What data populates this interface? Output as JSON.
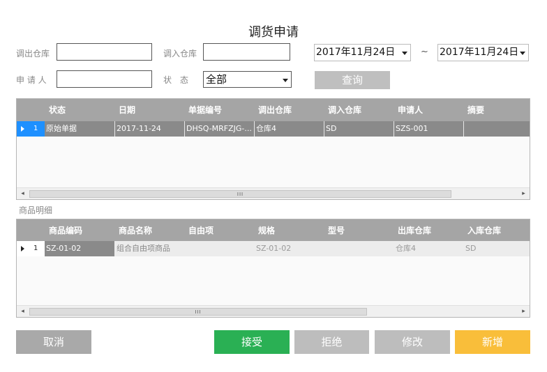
{
  "title": "调货申请",
  "filters": {
    "out_wh_label": "调出仓库",
    "out_wh_value": "",
    "in_wh_label": "调入仓库",
    "in_wh_value": "",
    "applicant_label": "申 请 人",
    "applicant_value": "",
    "status_label": "状　态",
    "status_value": "全部",
    "date_from": "2017年11月24日",
    "date_to": "2017年11月24日",
    "tilde": "~",
    "query_button": "查询"
  },
  "top_grid": {
    "columns": [
      "状态",
      "日期",
      "单据编号",
      "调出仓库",
      "调入仓库",
      "申请人",
      "摘要"
    ],
    "rows": [
      {
        "num": "1",
        "cells": [
          "原始单据",
          "2017-11-24",
          "DHSQ-MRFZJG-...",
          "仓库4",
          "SD",
          "SZS-001",
          ""
        ]
      }
    ],
    "scroll_grip": "III"
  },
  "detail_label": "商品明细",
  "bottom_grid": {
    "columns": [
      "商品编码",
      "商品名称",
      "自由项",
      "规格",
      "型号",
      "出库仓库",
      "入库仓库"
    ],
    "rows": [
      {
        "num": "1",
        "cells": [
          "SZ-01-02",
          "组合自由项商品",
          "",
          "SZ-01-02",
          "",
          "仓库4",
          "SD"
        ]
      }
    ],
    "scroll_grip": "III"
  },
  "buttons": {
    "cancel": "取消",
    "accept": "接受",
    "reject": "拒绝",
    "modify": "修改",
    "add": "新增"
  },
  "colors": {
    "accept": "#2ab054",
    "add": "#f9be3a",
    "neutral": "#a9a9a9",
    "header": "#a5a5a5",
    "selected_row_marker": "#1e90ff"
  }
}
